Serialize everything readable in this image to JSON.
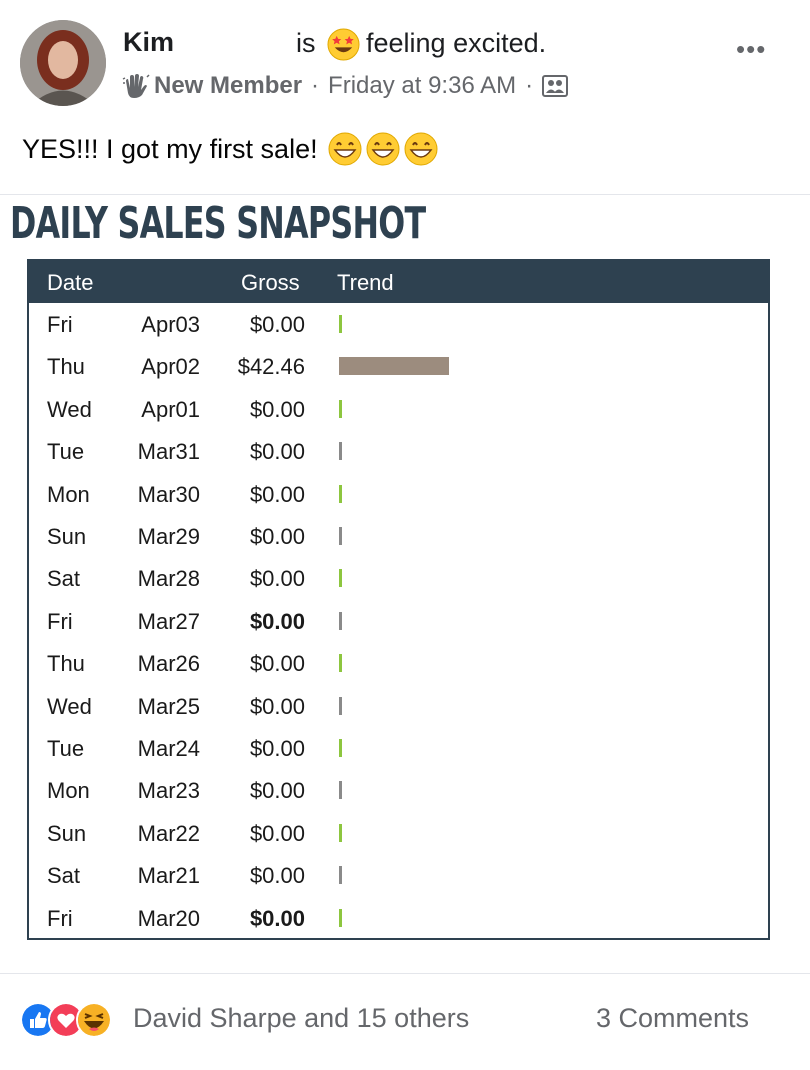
{
  "post": {
    "author": "Kim",
    "feeling_prefix": "is",
    "feeling_text": "feeling excited.",
    "badge": "New Member",
    "timestamp": "Friday at 9:36 AM",
    "sep": "·",
    "more": "•••",
    "text": "YES!!! I got my first sale!"
  },
  "snapshot": {
    "title": "DAILY SALES SNAPSHOT",
    "headers": {
      "date": "Date",
      "gross": "Gross",
      "trend": "Trend"
    },
    "rows": [
      {
        "day": "Fri",
        "date": "Apr03",
        "gross": "$0.00",
        "bold": false,
        "trend": 0,
        "trend_color": "#8dc63f"
      },
      {
        "day": "Thu",
        "date": "Apr02",
        "gross": "$42.46",
        "bold": false,
        "trend": 42.46,
        "trend_color": "#9c8c7e"
      },
      {
        "day": "Wed",
        "date": "Apr01",
        "gross": "$0.00",
        "bold": false,
        "trend": 0,
        "trend_color": "#8dc63f"
      },
      {
        "day": "Tue",
        "date": "Mar31",
        "gross": "$0.00",
        "bold": false,
        "trend": 0,
        "trend_color": "#8a8a8a"
      },
      {
        "day": "Mon",
        "date": "Mar30",
        "gross": "$0.00",
        "bold": false,
        "trend": 0,
        "trend_color": "#8dc63f"
      },
      {
        "day": "Sun",
        "date": "Mar29",
        "gross": "$0.00",
        "bold": false,
        "trend": 0,
        "trend_color": "#8a8a8a"
      },
      {
        "day": "Sat",
        "date": "Mar28",
        "gross": "$0.00",
        "bold": false,
        "trend": 0,
        "trend_color": "#8dc63f"
      },
      {
        "day": "Fri",
        "date": "Mar27",
        "gross": "$0.00",
        "bold": true,
        "trend": 0,
        "trend_color": "#8a8a8a"
      },
      {
        "day": "Thu",
        "date": "Mar26",
        "gross": "$0.00",
        "bold": false,
        "trend": 0,
        "trend_color": "#8dc63f"
      },
      {
        "day": "Wed",
        "date": "Mar25",
        "gross": "$0.00",
        "bold": false,
        "trend": 0,
        "trend_color": "#8a8a8a"
      },
      {
        "day": "Tue",
        "date": "Mar24",
        "gross": "$0.00",
        "bold": false,
        "trend": 0,
        "trend_color": "#8dc63f"
      },
      {
        "day": "Mon",
        "date": "Mar23",
        "gross": "$0.00",
        "bold": false,
        "trend": 0,
        "trend_color": "#8a8a8a"
      },
      {
        "day": "Sun",
        "date": "Mar22",
        "gross": "$0.00",
        "bold": false,
        "trend": 0,
        "trend_color": "#8dc63f"
      },
      {
        "day": "Sat",
        "date": "Mar21",
        "gross": "$0.00",
        "bold": false,
        "trend": 0,
        "trend_color": "#8a8a8a"
      },
      {
        "day": "Fri",
        "date": "Mar20",
        "gross": "$0.00",
        "bold": true,
        "trend": 0,
        "trend_color": "#8dc63f"
      }
    ]
  },
  "footer": {
    "reactions": [
      "like-icon",
      "love-icon",
      "haha-icon"
    ],
    "reaction_text": "David Sharpe and 15 others",
    "comments": "3 Comments"
  },
  "colors": {
    "header_bg": "#2e4150",
    "like": "#1877f2",
    "love": "#f33e58",
    "meta_text": "#65676b"
  }
}
